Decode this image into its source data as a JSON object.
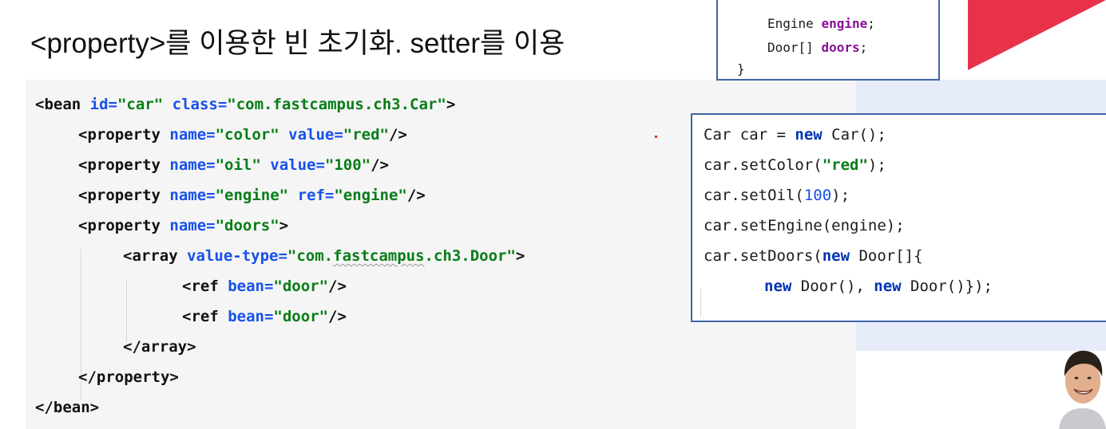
{
  "slide": {
    "title": "<property>를 이용한 빈 초기화. setter를 이용"
  },
  "xml_code": {
    "l1": {
      "open": "<bean ",
      "attr1": "id=",
      "val1": "\"car\"",
      "sp": " ",
      "attr2": "class=",
      "val2": "\"com.fastcampus.ch3.Car\"",
      "close": ">"
    },
    "l2": {
      "open": "<property ",
      "attr1": "name=",
      "val1": "\"color\"",
      "sp": " ",
      "attr2": "value=",
      "val2": "\"red\"",
      "close": "/>"
    },
    "l3": {
      "open": "<property ",
      "attr1": "name=",
      "val1": "\"oil\"",
      "sp": " ",
      "attr2": "value=",
      "val2": "\"100\"",
      "close": "/>"
    },
    "l4": {
      "open": "<property ",
      "attr1": "name=",
      "val1": "\"engine\"",
      "sp": " ",
      "attr2": "ref=",
      "val2": "\"engine\"",
      "close": "/>"
    },
    "l5": {
      "open": "<property ",
      "attr1": "name=",
      "val1": "\"doors\"",
      "close": ">"
    },
    "l6": {
      "open": "<array ",
      "attr1": "value-type=",
      "val1_pre": "\"com.",
      "val1_sq": "fastcampus",
      "val1_post": ".ch3.Door\"",
      "close": ">"
    },
    "l7": {
      "open": "<ref ",
      "attr1": "bean=",
      "val1": "\"door\"",
      "close": "/>"
    },
    "l8": {
      "open": "<ref ",
      "attr1": "bean=",
      "val1": "\"door\"",
      "close": "/>"
    },
    "l9": "</array>",
    "l10": "</property>",
    "l11": "</bean>"
  },
  "java_code": {
    "l1": {
      "a": "Car car = ",
      "kw": "new",
      "b": " Car();"
    },
    "l2": {
      "a": "car.setColor(",
      "str": "\"red\"",
      "b": ");"
    },
    "l3": {
      "a": "car.setOil(",
      "num": "100",
      "b": ");"
    },
    "l4": "car.setEngine(engine);",
    "l5": {
      "a": "car.setDoors(",
      "kw": "new",
      "b": " Door[]{"
    },
    "l6": {
      "kw1": "new",
      "a": " Door(), ",
      "kw2": "new",
      "b": " Door()});"
    }
  },
  "class_snippet": {
    "l1": {
      "type": "Engine ",
      "field": "engine",
      "end": ";"
    },
    "l2": {
      "type": "Door[] ",
      "field": "doors",
      "end": ";"
    },
    "l3": "}"
  },
  "colors": {
    "xml_tag": "#111111",
    "xml_attr": "#1750eb",
    "xml_string": "#067d17",
    "java_keyword": "#0033b3",
    "box_border": "#3f63a8",
    "brand_red": "#e8324a"
  },
  "icons": {
    "logo": "red-triangle-logo-icon",
    "presenter": "presenter-avatar-icon"
  }
}
